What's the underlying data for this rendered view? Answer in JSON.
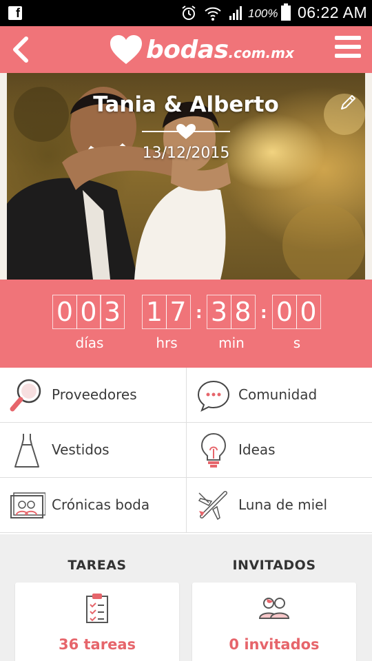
{
  "status_bar": {
    "battery": "100%",
    "time": "06:22 AM"
  },
  "app_bar": {
    "logo_word": "bodas",
    "logo_tld": ".com.mx"
  },
  "hero": {
    "couple": "Tania & Alberto",
    "date": "13/12/2015"
  },
  "countdown": {
    "days": [
      "0",
      "0",
      "3"
    ],
    "hours": [
      "1",
      "7"
    ],
    "minutes": [
      "3",
      "8"
    ],
    "seconds": [
      "0",
      "0"
    ],
    "labels": {
      "days": "días",
      "hours": "hrs",
      "minutes": "min",
      "seconds": "s"
    }
  },
  "menu_items": [
    {
      "label": "Proveedores",
      "icon": "magnifier-icon"
    },
    {
      "label": "Comunidad",
      "icon": "chat-bubble-icon"
    },
    {
      "label": "Vestidos",
      "icon": "dress-icon"
    },
    {
      "label": "Ideas",
      "icon": "lightbulb-icon"
    },
    {
      "label": "Crónicas boda",
      "icon": "photo-album-icon"
    },
    {
      "label": "Luna de miel",
      "icon": "airplane-icon"
    }
  ],
  "sections": {
    "tasks": {
      "title": "TAREAS",
      "count": "36 tareas"
    },
    "guests": {
      "title": "INVITADOS",
      "count": "0 invitados"
    }
  },
  "colors": {
    "brand": "#f07479",
    "accent_text": "#e6656b"
  }
}
